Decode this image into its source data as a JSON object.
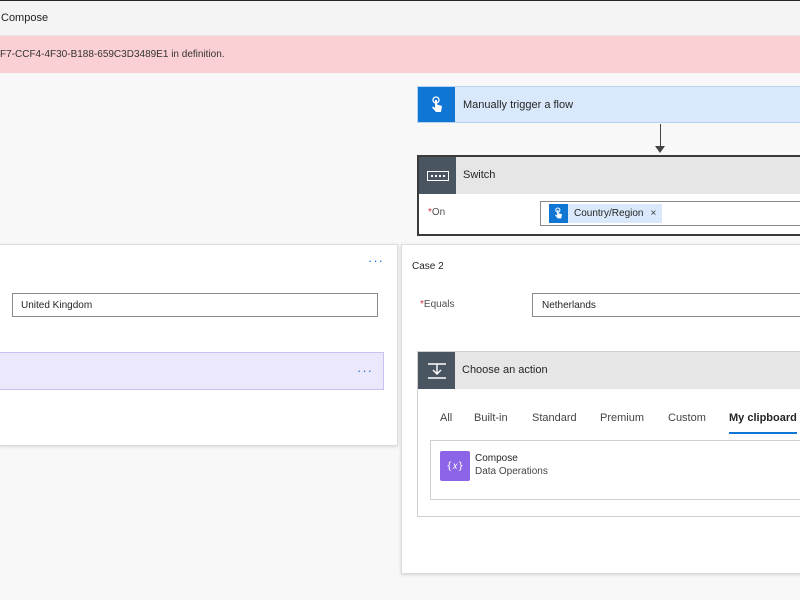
{
  "header": {
    "title": "Compose"
  },
  "error": {
    "message": "F7-CCF4-4F30-B188-659C3D3489E1 in definition."
  },
  "trigger": {
    "label": "Manually trigger a flow",
    "icon": "hand-tap-icon",
    "color": "#0f76d4"
  },
  "switch": {
    "title": "Switch",
    "icon": "switch-icon",
    "on_label": "On",
    "required_mark": "*",
    "token": {
      "text": "Country/Region",
      "remove": "×",
      "icon": "hand-tap-icon"
    }
  },
  "case1": {
    "menu": "···",
    "value": "United Kingdom",
    "action_menu": "···"
  },
  "case2": {
    "title": "Case 2",
    "equals_label": "Equals",
    "required_mark": "*",
    "value": "Netherlands",
    "choose_action": {
      "title": "Choose an action",
      "icon": "action-icon",
      "tabs": [
        "All",
        "Built-in",
        "Standard",
        "Premium",
        "Custom",
        "My clipboard"
      ],
      "active_tab": "My clipboard",
      "result": {
        "title": "Compose",
        "subtitle": "Data Operations",
        "icon_glyph": "{𝑥}",
        "color": "#8b64e8"
      }
    }
  }
}
